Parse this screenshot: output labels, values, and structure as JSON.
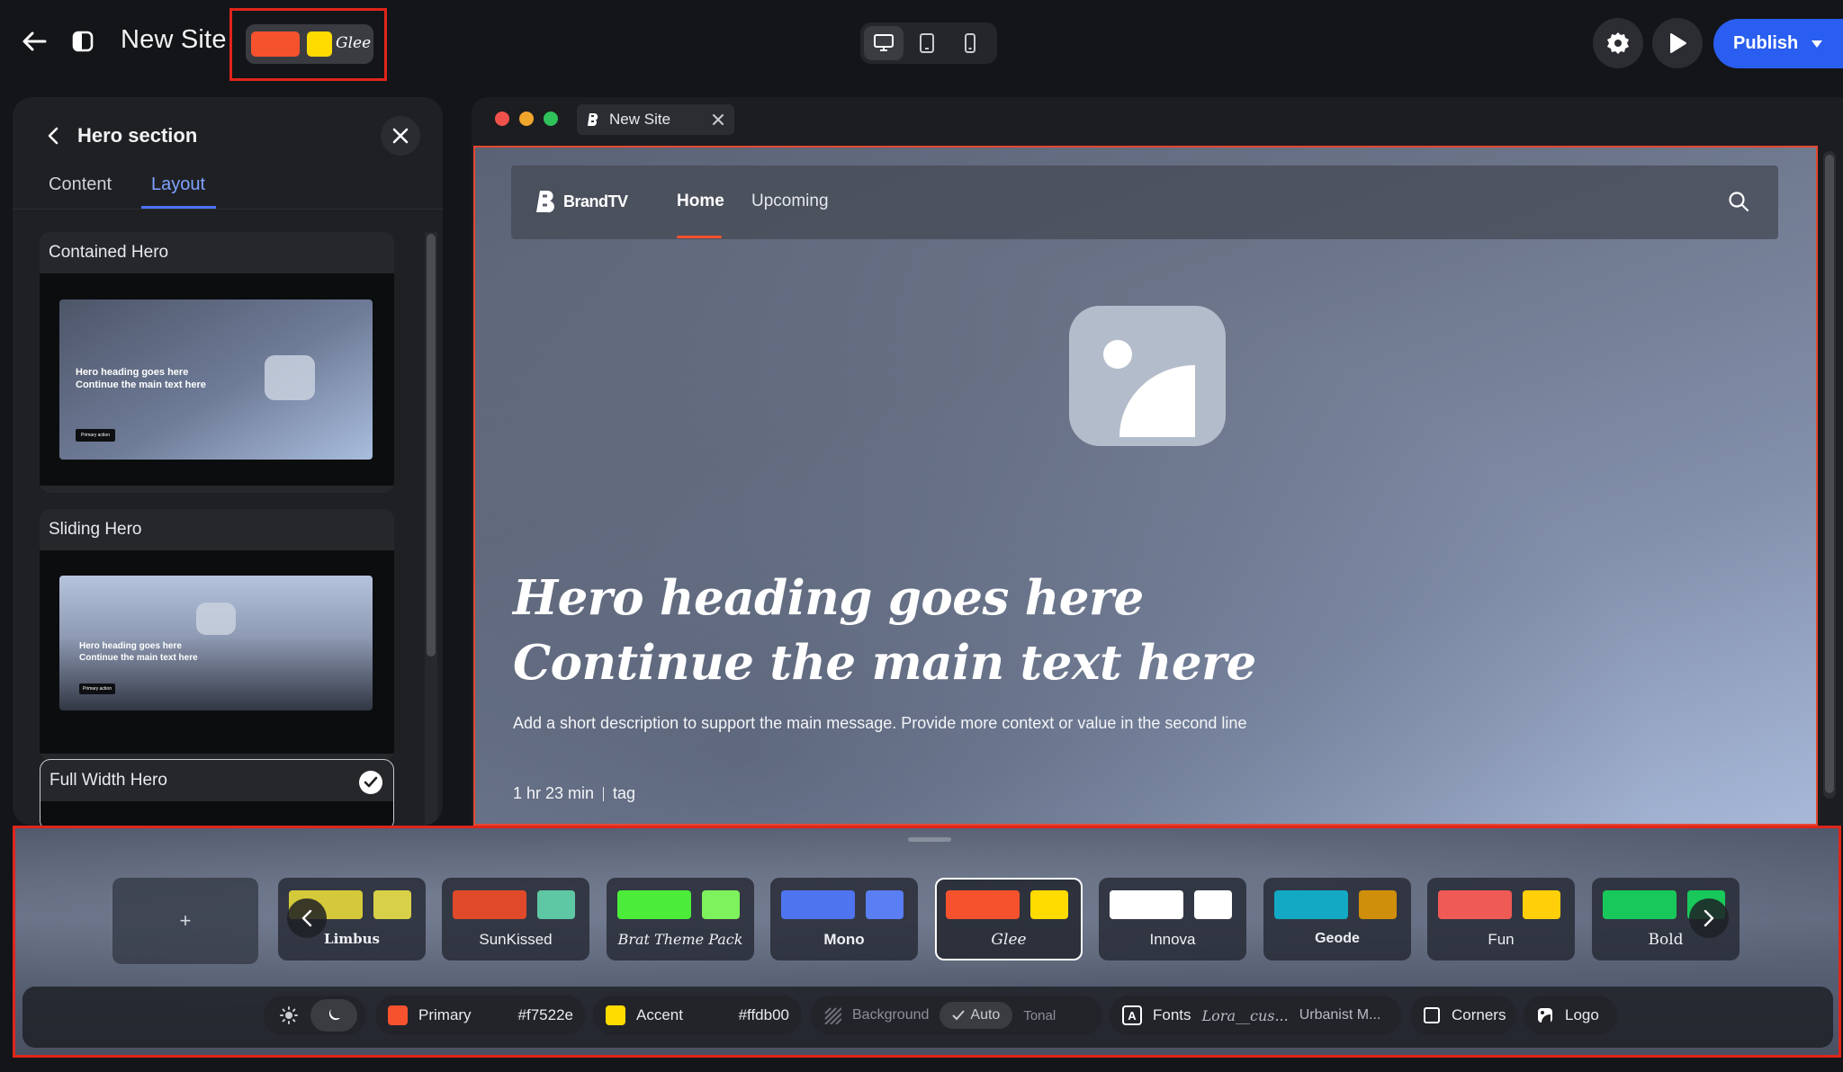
{
  "header": {
    "site_title": "New Site",
    "theme_name": "Glee",
    "publish_label": "Publish"
  },
  "panel": {
    "title": "Hero section",
    "tabs": [
      "Content",
      "Layout"
    ],
    "active_tab": "Layout",
    "layouts": [
      {
        "name": "Contained Hero",
        "heading": "Hero heading goes here\nContinue the main text here",
        "button": "Primary action",
        "meta": "1 hr 23 min  |  tag"
      },
      {
        "name": "Sliding Hero",
        "heading": "Hero heading goes here\nContinue the main text here",
        "button": "Primary action"
      },
      {
        "name": "Full Width Hero",
        "selected": true
      }
    ]
  },
  "preview": {
    "tab_label": "New Site",
    "brand": "BrandTV",
    "nav": [
      "Home",
      "Upcoming"
    ],
    "active_nav": "Home",
    "hero_line1": "Hero heading goes here",
    "hero_line2": "Continue the main text here",
    "hero_desc": "Add a short description to support the main message. Provide more context or value in the second line",
    "duration": "1 hr 23 min",
    "tag": "tag"
  },
  "themes": {
    "add_label": "+",
    "items": [
      {
        "name": "Limbus",
        "c1": "#d4c93a",
        "c2": "#d8d048"
      },
      {
        "name": "SunKissed",
        "c1": "#e04a2a",
        "c2": "#5ec7a4"
      },
      {
        "name": "Brat Theme Pack",
        "c1": "#4ced3a",
        "c2": "#7ef25c"
      },
      {
        "name": "Mono",
        "c1": "#4f74f0",
        "c2": "#5a7ef4"
      },
      {
        "name": "Glee",
        "c1": "#f7522e",
        "c2": "#ffdb00",
        "selected": true
      },
      {
        "name": "Innova",
        "c1": "#ffffff",
        "c2": "#ffffff"
      },
      {
        "name": "Geode",
        "c1": "#13a9c4",
        "c2": "#cf8f0a"
      },
      {
        "name": "Fun",
        "c1": "#f05a55",
        "c2": "#ffcf0a"
      },
      {
        "name": "Bold",
        "c1": "#19c85a",
        "c2": "#19c85a"
      }
    ]
  },
  "toolbar": {
    "primary_label": "Primary",
    "primary_value": "#f7522e",
    "accent_label": "Accent",
    "accent_value": "#ffdb00",
    "background_label": "Background",
    "auto_label": "Auto",
    "tonal_label": "Tonal",
    "fonts_label": "Fonts",
    "font1": "Lora__cus...",
    "font2": "Urbanist M...",
    "corners_label": "Corners",
    "logo_label": "Logo"
  }
}
